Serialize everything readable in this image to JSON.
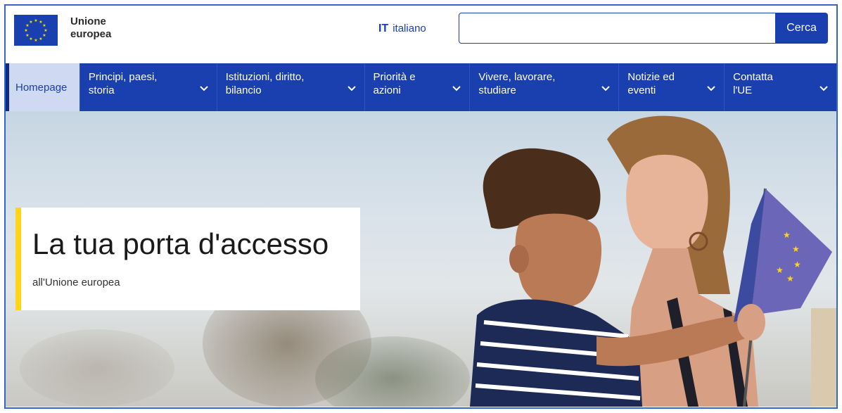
{
  "header": {
    "logo_line1": "Unione",
    "logo_line2": "europea",
    "lang_code": "IT",
    "lang_name": "italiano",
    "search_placeholder": "",
    "search_button": "Cerca"
  },
  "nav": {
    "home": "Homepage",
    "items": [
      {
        "line1": "Principi, paesi,",
        "line2": "storia"
      },
      {
        "line1": "Istituzioni, diritto,",
        "line2": "bilancio"
      },
      {
        "line1": "Priorità e",
        "line2": "azioni"
      },
      {
        "line1": "Vivere, lavorare,",
        "line2": "studiare"
      },
      {
        "line1": "Notizie ed",
        "line2": "eventi"
      },
      {
        "line1": "Contatta",
        "line2": "l'UE"
      }
    ]
  },
  "hero": {
    "title": "La tua porta d'accesso",
    "subtitle": "all'Unione europea"
  },
  "colors": {
    "eu_blue": "#1a3faf",
    "accent_yellow": "#ffd617",
    "home_bg": "#cfd9f1"
  }
}
